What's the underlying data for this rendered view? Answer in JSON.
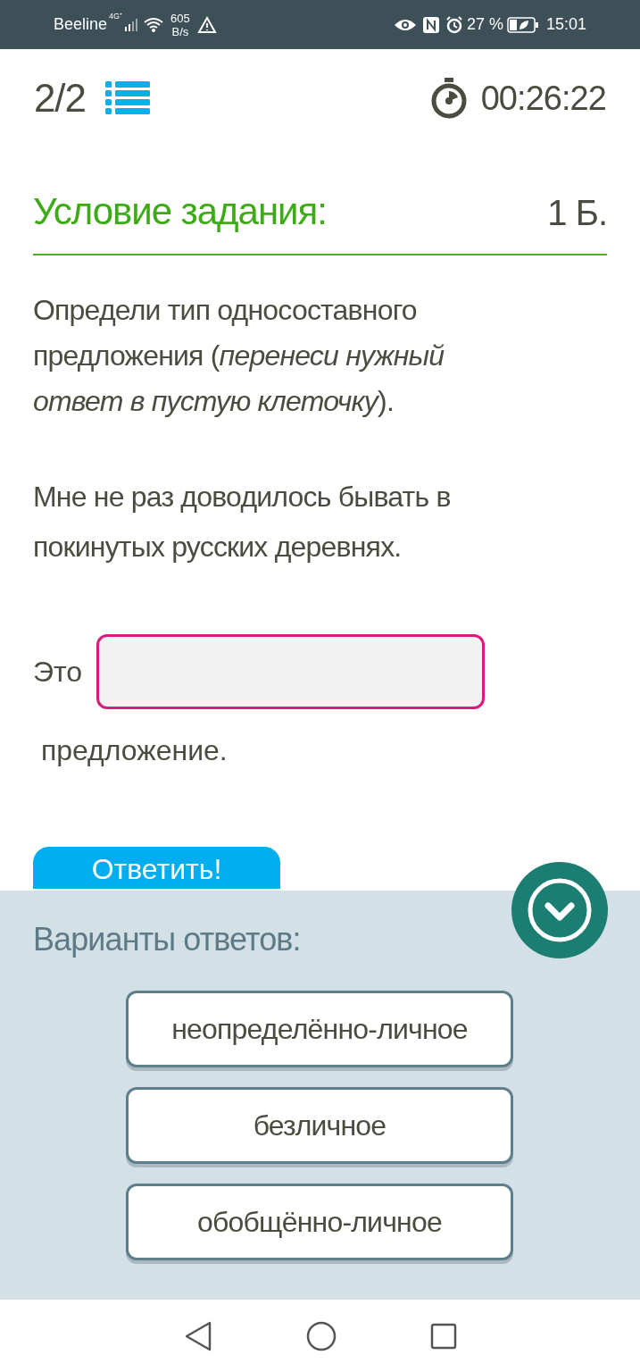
{
  "status_bar": {
    "carrier": "Beeline",
    "network": "4G⁺",
    "speed_value": "605",
    "speed_unit": "B/s",
    "battery": "27 %",
    "time": "15:01"
  },
  "header": {
    "progress": "2/2",
    "timer": "00:26:22"
  },
  "task": {
    "title": "Условие задания:",
    "points": "1 Б.",
    "instruction": "Определи тип односоставного предложения (*перенеси нужный ответ в пустую клеточку*).",
    "sentence": "Мне не раз доводилось бывать в покинутых русских деревнях.",
    "prefix": "Это",
    "suffix": " предложение.",
    "submit": "Ответить!"
  },
  "answers": {
    "title": "Варианты ответов:",
    "options": [
      {
        "label": "неопределённо-личное"
      },
      {
        "label": "безличное"
      },
      {
        "label": "обобщённо-личное"
      }
    ]
  }
}
